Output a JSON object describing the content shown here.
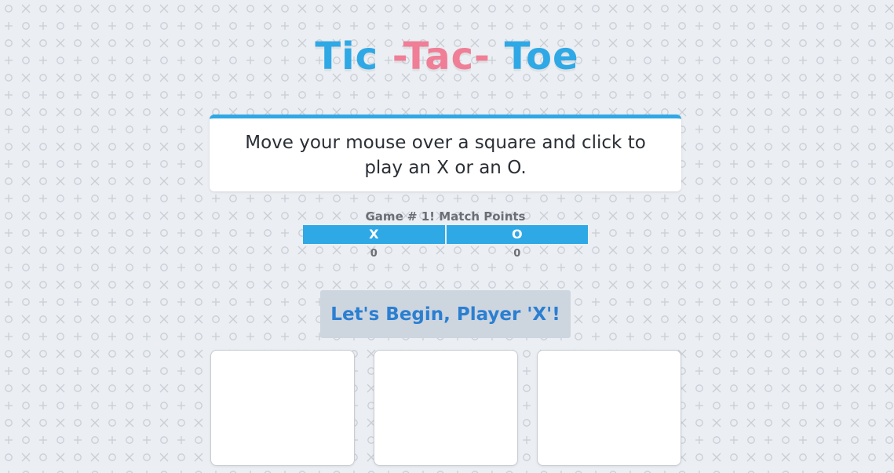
{
  "title": {
    "part1": "Tic ",
    "part2": "-Tac-",
    "part3": " Toe"
  },
  "instructions": "Move your mouse over a square and click to play an X or an O.",
  "scoreboard": {
    "heading": "Game # 1! Match Points",
    "players": [
      {
        "label": "X",
        "points": "0"
      },
      {
        "label": "O",
        "points": "0"
      }
    ]
  },
  "status": "Let's Begin, Player 'X'!",
  "colors": {
    "accent_blue": "#2fa8e6",
    "accent_pink": "#ef7e96",
    "status_text": "#2b7fd1",
    "status_bg": "#cdd5df"
  },
  "board": {
    "visible_cells": [
      "",
      "",
      ""
    ]
  }
}
